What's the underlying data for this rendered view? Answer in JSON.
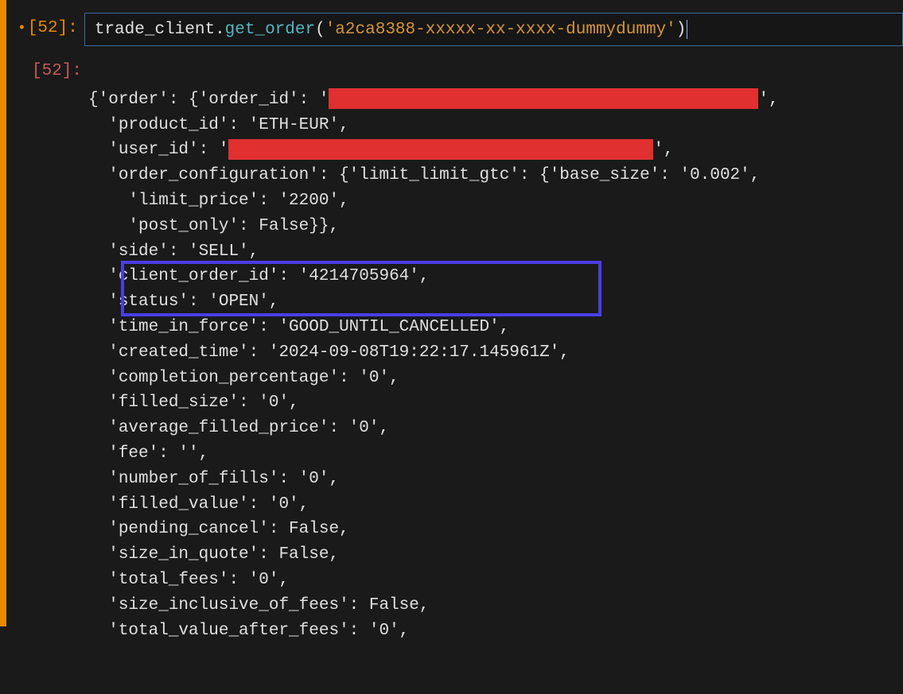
{
  "prompt_in_label": "[52]:",
  "prompt_out_label": "[52]:",
  "input_code": {
    "var": "trade_client",
    "dot": ".",
    "func": "get_order",
    "open": "(",
    "arg": "'a2ca8388-xxxxx-xx-xxxx-dummydummy'",
    "close": ")"
  },
  "output_lines": {
    "l0_a": "{'order': {'order_id': '",
    "l0_b": "',",
    "l1": "  'product_id': 'ETH-EUR',",
    "l2_a": "  'user_id': '",
    "l2_b": "',",
    "l3": "  'order_configuration': {'limit_limit_gtc': {'base_size': '0.002',",
    "l4": "    'limit_price': '2200',",
    "l5": "    'post_only': False}},",
    "l6": "  'side': 'SELL',",
    "l7": "  'client_order_id': '4214705964',",
    "l8": "  'status': 'OPEN',",
    "l9": "  'time_in_force': 'GOOD_UNTIL_CANCELLED',",
    "l10": "  'created_time': '2024-09-08T19:22:17.145961Z',",
    "l11": "  'completion_percentage': '0',",
    "l12": "  'filled_size': '0',",
    "l13": "  'average_filled_price': '0',",
    "l14": "  'fee': '',",
    "l15": "  'number_of_fills': '0',",
    "l16": "  'filled_value': '0',",
    "l17": "  'pending_cancel': False,",
    "l18": "  'size_in_quote': False,",
    "l19": "  'total_fees': '0',",
    "l20": "  'size_inclusive_of_fees': False,",
    "l21": "  'total_value_after_fees': '0',"
  }
}
